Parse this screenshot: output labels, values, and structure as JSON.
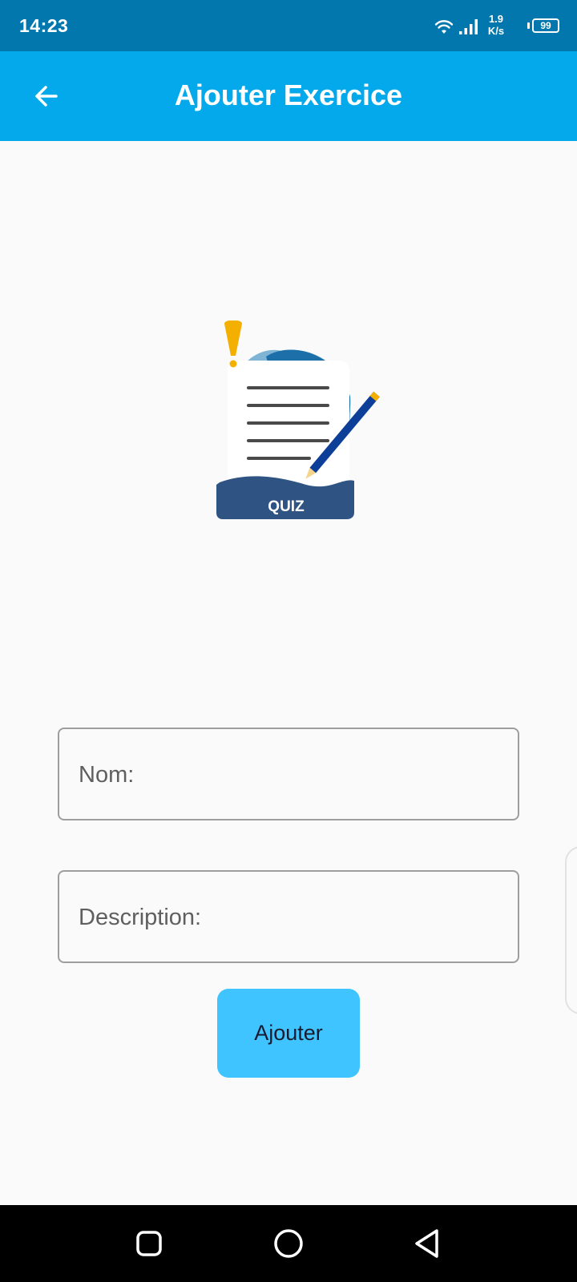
{
  "status_bar": {
    "time": "14:23",
    "net_speed_value": "1.9",
    "net_speed_unit": "K/s",
    "battery_level": "99",
    "background": "#0277ad"
  },
  "app_bar": {
    "title": "Ajouter Exercice",
    "back_icon": "arrow-left-icon",
    "background": "#03a9ea"
  },
  "illustration": {
    "icon": "quiz-clipboard-illustration",
    "badge_text": "QUIZ"
  },
  "form": {
    "name_placeholder": "Nom:",
    "name_value": "",
    "description_placeholder": "Description:",
    "description_value": "",
    "submit_label": "Ajouter",
    "submit_color": "#40c4ff"
  },
  "nav_bar": {
    "recents_icon": "recents-square-icon",
    "home_icon": "home-circle-icon",
    "back_icon": "back-triangle-icon"
  }
}
